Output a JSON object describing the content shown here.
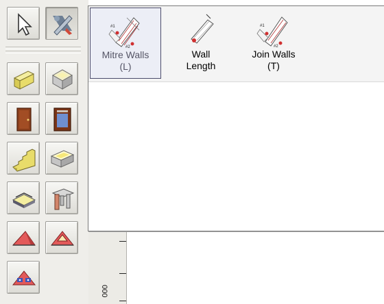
{
  "toolbar": {
    "buttons": [
      {
        "id": "select",
        "icon": "arrow-pointer-icon"
      },
      {
        "id": "wall-tools",
        "icon": "wall-tools-icon",
        "active": true
      },
      {
        "id": "walls",
        "icon": "wall-icon"
      },
      {
        "id": "rooms",
        "icon": "room-box-icon"
      },
      {
        "id": "doors",
        "icon": "door-icon"
      },
      {
        "id": "windows",
        "icon": "window-icon"
      },
      {
        "id": "stairs",
        "icon": "stairs-icon"
      },
      {
        "id": "pool",
        "icon": "pool-icon"
      },
      {
        "id": "deck",
        "icon": "deck-icon"
      },
      {
        "id": "columns",
        "icon": "column-icon"
      },
      {
        "id": "roof",
        "icon": "roof-icon"
      },
      {
        "id": "roof-window",
        "icon": "roof-window-icon"
      },
      {
        "id": "roof-dormer",
        "icon": "roof-dormer-icon"
      }
    ]
  },
  "flyout": {
    "items": [
      {
        "line1": "Mitre Walls",
        "line2": "(L)",
        "icon": "mitre-walls-icon",
        "selected": true
      },
      {
        "line1": "Wall",
        "line2": "Length",
        "icon": "wall-length-icon",
        "selected": false
      },
      {
        "line1": "Join Walls",
        "line2": "(T)",
        "icon": "join-walls-icon",
        "selected": false
      }
    ]
  },
  "ruler": {
    "label": "000"
  },
  "colors": {
    "toolbar_bg": "#efeeea",
    "wall_yellow": "#e8dc6a",
    "door_brown": "#8a3f1c",
    "roof_red": "#e35a5a",
    "selection_border": "#4a4a6a"
  }
}
